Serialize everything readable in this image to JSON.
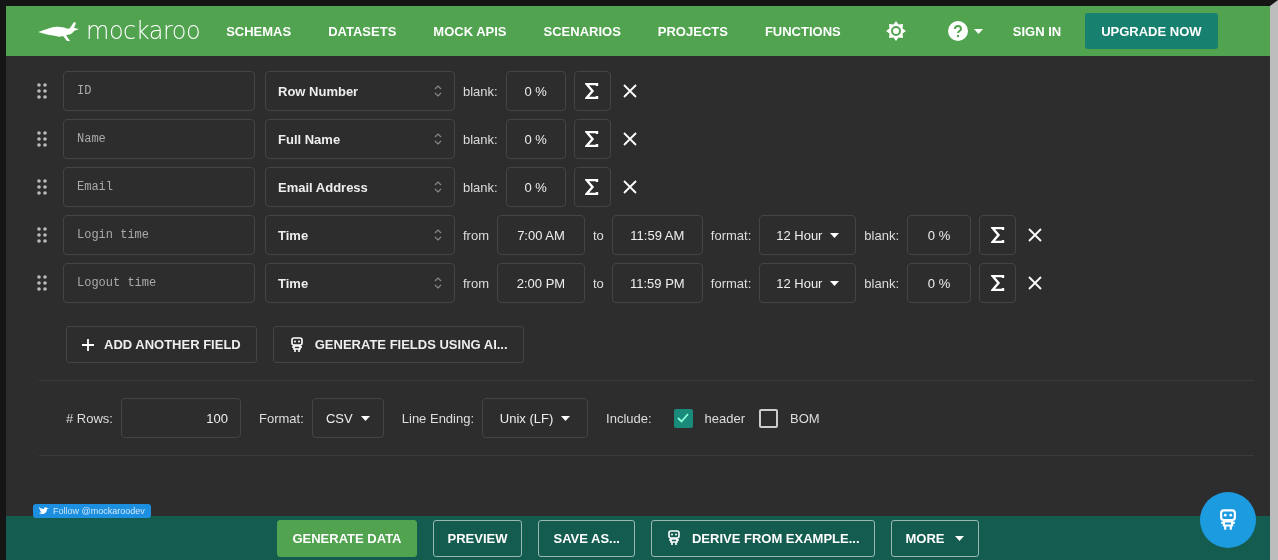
{
  "header": {
    "logo": "mockaroo",
    "nav": [
      {
        "label": "SCHEMAS"
      },
      {
        "label": "DATASETS"
      },
      {
        "label": "MOCK APIS"
      },
      {
        "label": "SCENARIOS"
      },
      {
        "label": "PROJECTS"
      },
      {
        "label": "FUNCTIONS"
      }
    ],
    "sign_in": "SIGN IN",
    "upgrade": "UPGRADE NOW"
  },
  "fields": [
    {
      "kind": "simple",
      "name": "ID",
      "type": "Row Number",
      "blank_label": "blank:",
      "blank": "0 %"
    },
    {
      "kind": "simple",
      "name": "Name",
      "type": "Full Name",
      "blank_label": "blank:",
      "blank": "0 %"
    },
    {
      "kind": "simple",
      "name": "Email",
      "type": "Email Address",
      "blank_label": "blank:",
      "blank": "0 %"
    },
    {
      "kind": "time",
      "name": "Login time",
      "type": "Time",
      "from_label": "from",
      "from": "7:00 AM",
      "to_label": "to",
      "to": "11:59 AM",
      "format_label": "format:",
      "format": "12 Hour",
      "blank_label": "blank:",
      "blank": "0 %"
    },
    {
      "kind": "time",
      "name": "Logout time",
      "type": "Time",
      "from_label": "from",
      "from": "2:00 PM",
      "to_label": "to",
      "to": "11:59 PM",
      "format_label": "format:",
      "format": "12 Hour",
      "blank_label": "blank:",
      "blank": "0 %"
    }
  ],
  "actions": [
    {
      "label": "ADD ANOTHER FIELD"
    },
    {
      "label": "GENERATE FIELDS USING AI..."
    }
  ],
  "options": {
    "rows_label": "# Rows:",
    "rows": "100",
    "format_label": "Format:",
    "format": "CSV",
    "line_ending_label": "Line Ending:",
    "line_ending": "Unix (LF)",
    "include_label": "Include:",
    "checkboxes": [
      {
        "label": "header",
        "checked": true
      },
      {
        "label": "BOM",
        "checked": false
      }
    ]
  },
  "twitter": "Follow @mockaroodev",
  "footer": [
    {
      "label": "GENERATE DATA",
      "kind": "primary"
    },
    {
      "label": "PREVIEW",
      "kind": "outline"
    },
    {
      "label": "SAVE AS...",
      "kind": "outline"
    },
    {
      "label": "DERIVE FROM EXAMPLE...",
      "kind": "outline"
    },
    {
      "label": "MORE",
      "kind": "outline"
    }
  ]
}
